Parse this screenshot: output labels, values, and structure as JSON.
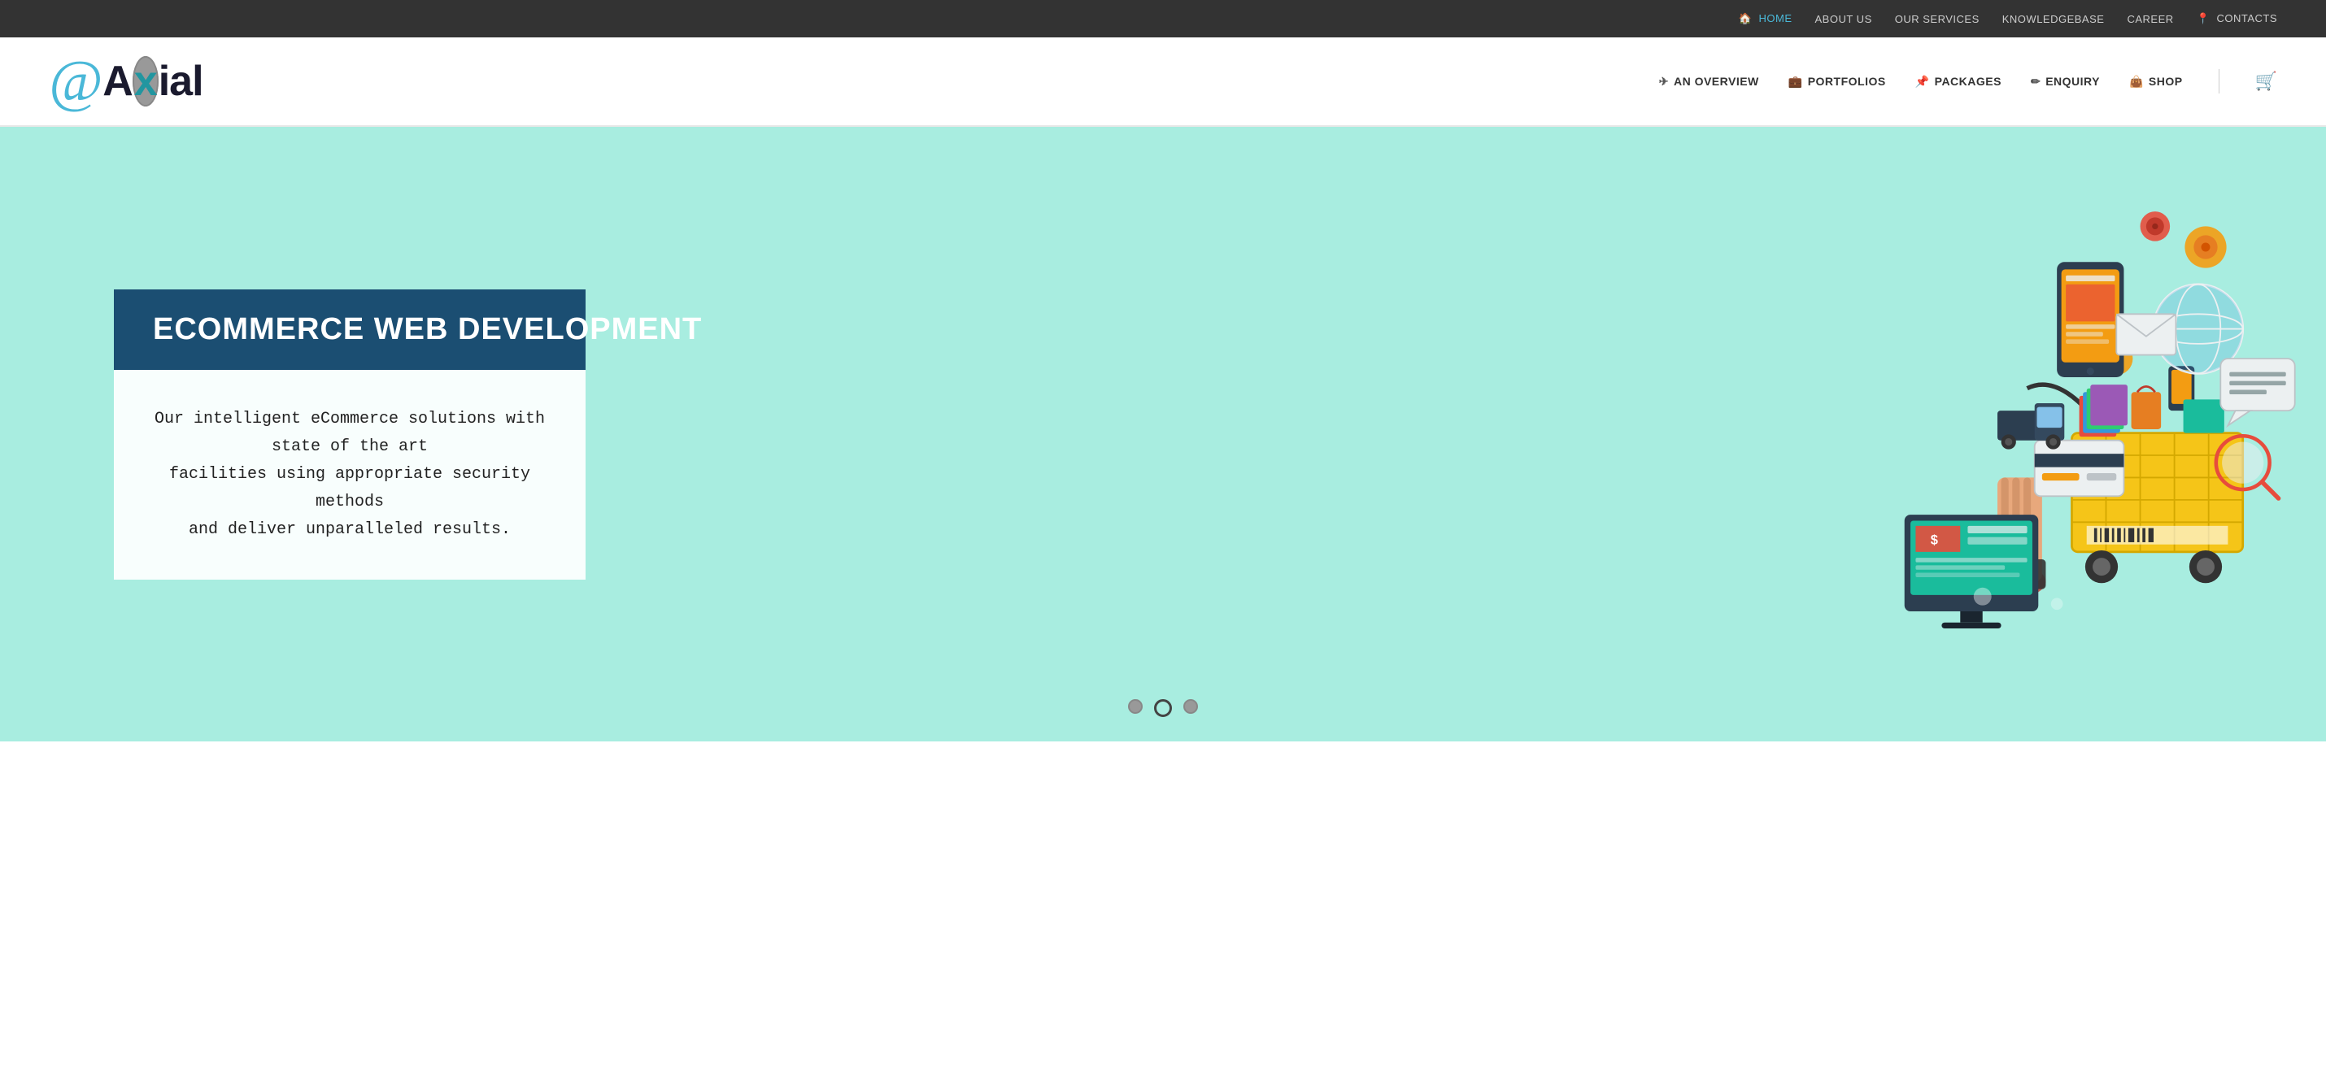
{
  "topbar": {
    "nav": [
      {
        "label": "HOME",
        "href": "#",
        "active": true,
        "icon": "🏠"
      },
      {
        "label": "ABOUT US",
        "href": "#",
        "active": false
      },
      {
        "label": "OUR SERVICES",
        "href": "#",
        "active": false
      },
      {
        "label": "KNOWLEDGEBASE",
        "href": "#",
        "active": false
      },
      {
        "label": "CAREER",
        "href": "#",
        "active": false
      },
      {
        "label": "CONTACTS",
        "href": "#",
        "active": false,
        "icon": "📍"
      }
    ]
  },
  "header": {
    "logo_at": "@",
    "logo_name": "Axial",
    "nav": [
      {
        "label": "AN OVERVIEW",
        "icon": "✈"
      },
      {
        "label": "PORTFOLIOS",
        "icon": "💼"
      },
      {
        "label": "PACKAGES",
        "icon": "📌"
      },
      {
        "label": "ENQUIRY",
        "icon": "✏"
      },
      {
        "label": "SHOP",
        "icon": "👜"
      }
    ]
  },
  "hero": {
    "slide_title": "ECOMMERCE WEB DEVELOPMENT",
    "slide_desc": "Our intelligent eCommerce solutions with state of the art\nfacilities using appropriate security methods\nand deliver unparalleled results.",
    "dots": [
      {
        "active": false
      },
      {
        "active": true
      },
      {
        "active": false
      }
    ],
    "bg_color": "#a8ede0",
    "title_bg": "#1b4e72"
  },
  "colors": {
    "accent": "#4ab8d8",
    "dark_nav": "#1b4e72",
    "top_bar_bg": "#333333"
  }
}
